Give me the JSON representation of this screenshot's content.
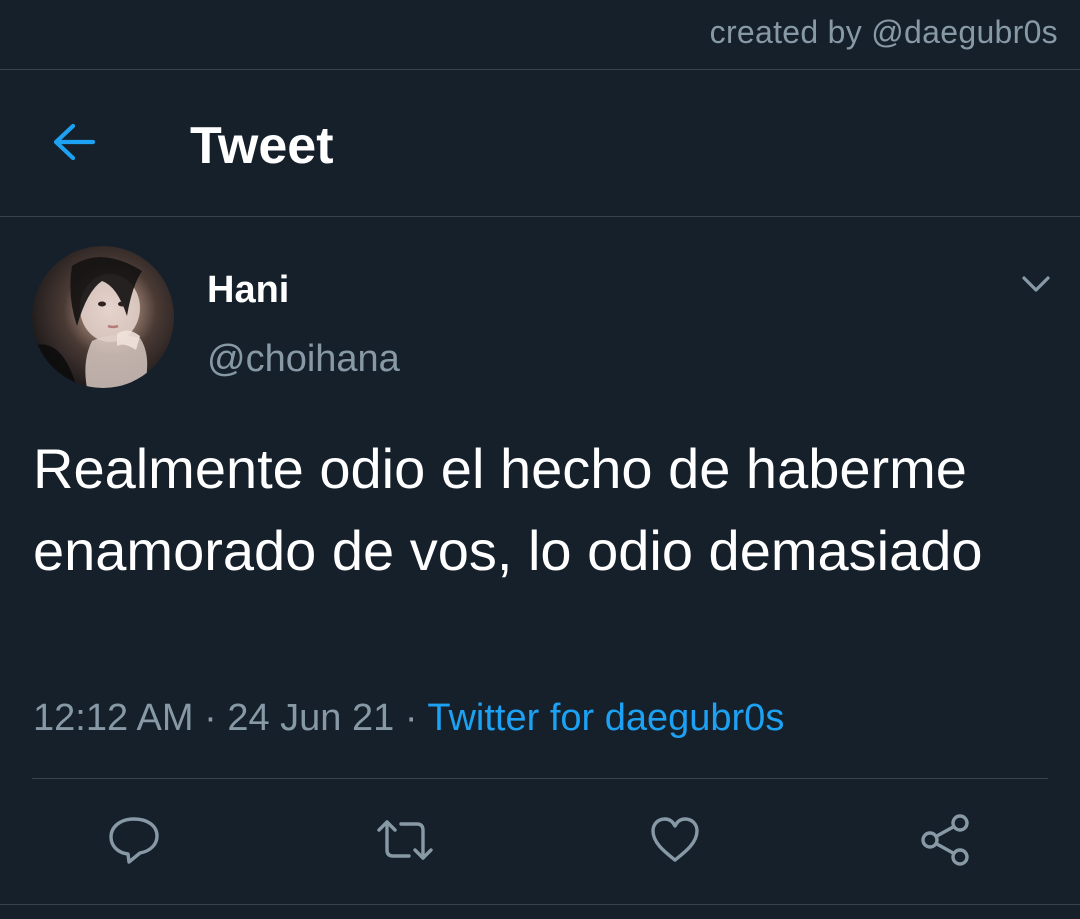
{
  "watermark": "created by @daegubr0s",
  "header": {
    "title": "Tweet",
    "back_icon": "arrow-left-icon"
  },
  "tweet": {
    "author": {
      "name": "Hani",
      "handle": "@choihana",
      "avatar": "profile-photo"
    },
    "text": "Realmente odio el hecho de haberme enamorado de vos, lo odio demasiado",
    "time": "12:12 AM",
    "separator": "·",
    "date": "24 Jun 21",
    "source": "Twitter for daegubr0s",
    "more_icon": "chevron-down-icon"
  },
  "actions": [
    {
      "icon": "reply-icon"
    },
    {
      "icon": "retweet-icon"
    },
    {
      "icon": "like-icon"
    },
    {
      "icon": "share-icon"
    }
  ],
  "colors": {
    "background": "#15202b",
    "accent": "#1da1f2",
    "secondary_text": "#8899a6",
    "divider": "#38444d"
  }
}
